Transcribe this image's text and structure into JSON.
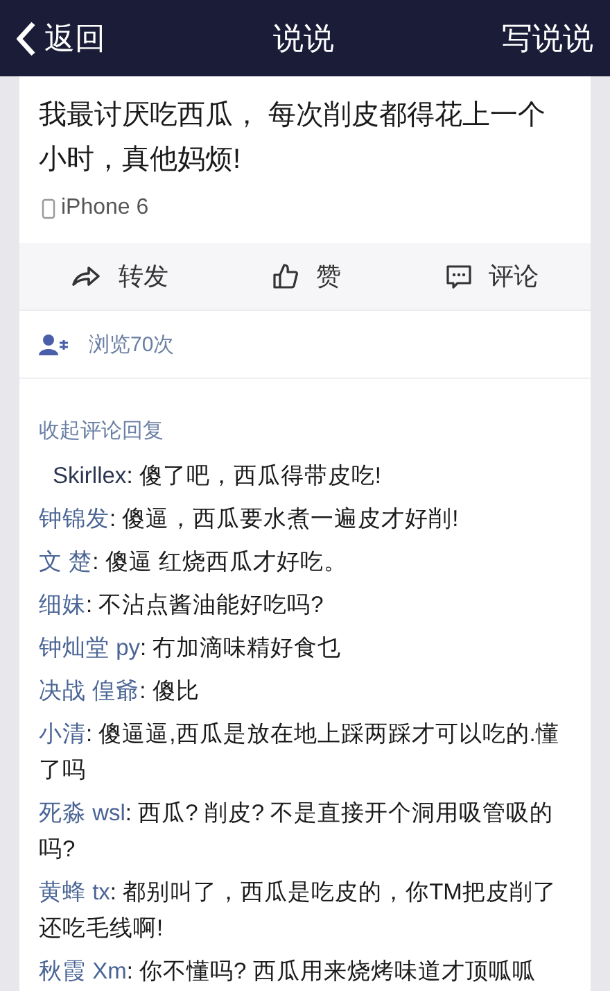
{
  "nav": {
    "back": "返回",
    "title": "说说",
    "action": "写说说"
  },
  "post": {
    "text": "我最讨厌吃西瓜， 每次削皮都得花上一个小时，真他妈烦!",
    "device": "iPhone 6"
  },
  "actions": [
    {
      "kind": "share",
      "label": "转发"
    },
    {
      "kind": "like",
      "label": "赞"
    },
    {
      "kind": "comment",
      "label": "评论"
    }
  ],
  "views": "浏览70次",
  "collapse": "收起评论回复",
  "comments": [
    {
      "name": "Skirllex",
      "text": ": 傻了吧，西瓜得带皮吃!"
    },
    {
      "name": "钟锦发",
      "text": ": 傻逼，西瓜要水煮一遍皮才好削!"
    },
    {
      "name": "文 楚",
      "text": ": 傻逼  红烧西瓜才好吃。"
    },
    {
      "name": "细妹",
      "text": ": 不沾点酱油能好吃吗?"
    },
    {
      "name": "钟灿堂 py",
      "text": ": 冇加滴味精好食乜"
    },
    {
      "name": "决战  偟爺",
      "text": ": 傻比"
    },
    {
      "name": "小清",
      "text": ": 傻逼逼,西瓜是放在地上踩两踩才可以吃的.懂了吗"
    },
    {
      "name": "死淼 wsl",
      "text": ": 西瓜? 削皮? 不是直接开个洞用吸管吸的吗?"
    },
    {
      "name": "黄蜂 tx",
      "text": ": 都别叫了，西瓜是吃皮的，你TM把皮削了还吃毛线啊!"
    },
    {
      "name": "秋霞 Xm",
      "text": ": 你不懂吗? 西瓜用来烧烤味道才顶呱呱"
    }
  ]
}
